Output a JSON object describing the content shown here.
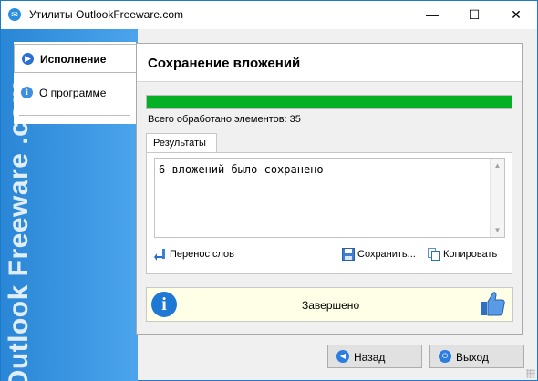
{
  "window": {
    "title": "Утилиты OutlookFreeware.com",
    "controls": {
      "minimize": "—",
      "maximize": "☐",
      "close": "✕"
    }
  },
  "sidebar": {
    "brand": "Outlook Freeware .com",
    "items": [
      {
        "label": "Исполнение",
        "icon": "play-icon",
        "active": true
      },
      {
        "label": "О программе",
        "icon": "info-icon",
        "active": false
      }
    ]
  },
  "main": {
    "title": "Сохранение вложений",
    "progress_percent": 100,
    "processed_label": "Всего обработано элементов: 35",
    "tab_label": "Результаты",
    "results_text": "6 вложений было сохранено",
    "toolbar": {
      "wrap_label": "Перенос слов",
      "save_label": "Сохранить...",
      "copy_label": "Копировать"
    },
    "status": {
      "text": "Завершено",
      "icon": "info-icon",
      "thumb_icon": "thumbs-up-icon"
    }
  },
  "footer": {
    "back_label": "Назад",
    "exit_label": "Выход"
  },
  "colors": {
    "accent": "#2a86d6",
    "progress": "#06b025",
    "status_bg": "#fffee6"
  }
}
